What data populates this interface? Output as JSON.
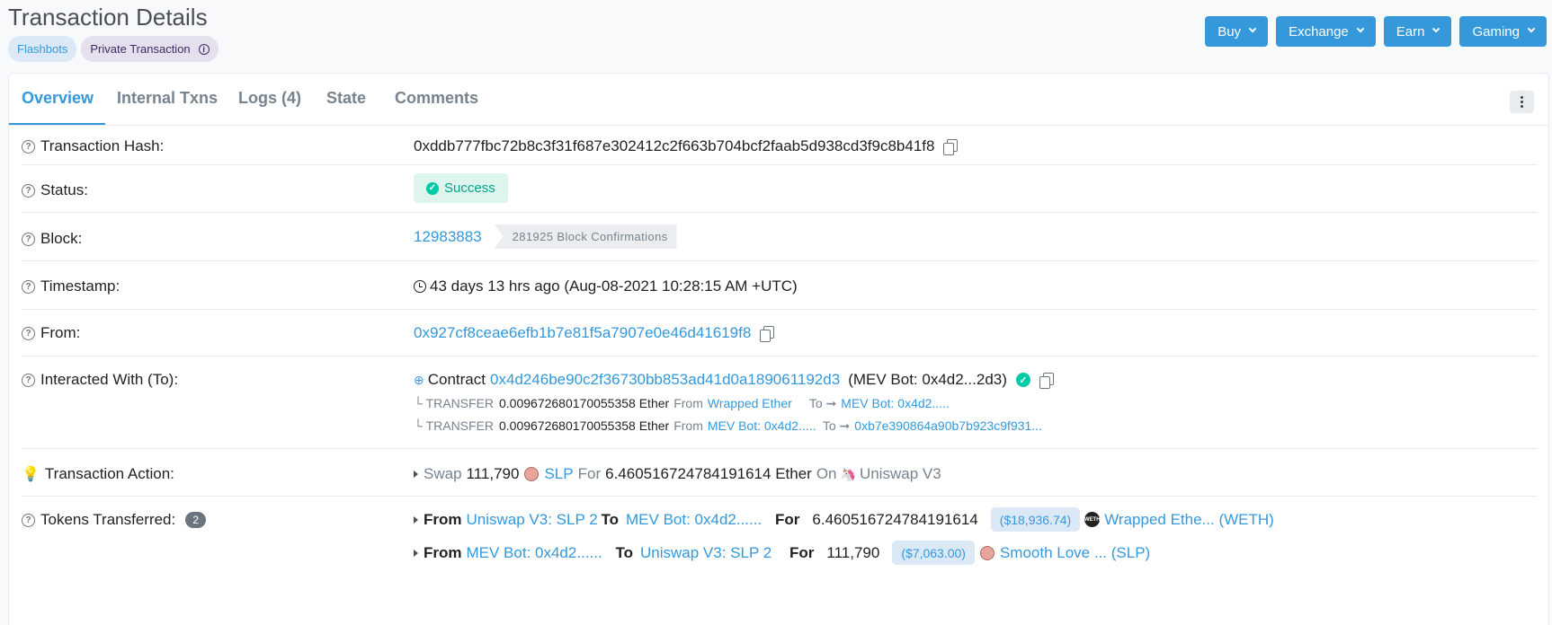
{
  "page": {
    "title": "Transaction Details",
    "badges": [
      "Flashbots",
      "Private Transaction"
    ]
  },
  "top_buttons": [
    "Buy",
    "Exchange",
    "Earn",
    "Gaming"
  ],
  "tabs": [
    "Overview",
    "Internal Txns",
    "Logs (4)",
    "State",
    "Comments"
  ],
  "details": {
    "hash": {
      "label": "Transaction Hash:",
      "value": "0xddb777fbc72b8c3f31f687e302412c2f663b704bcf2faab5d938cd3f9c8b41f8"
    },
    "status": {
      "label": "Status:",
      "value": "Success"
    },
    "block": {
      "label": "Block:",
      "value": "12983883",
      "confirmations": "281925 Block Confirmations"
    },
    "timestamp": {
      "label": "Timestamp:",
      "value": "43 days 13 hrs ago (Aug-08-2021 10:28:15 AM +UTC)"
    },
    "from": {
      "label": "From:",
      "value": "0x927cf8ceae6efb1b7e81f5a7907e0e46d41619f8"
    },
    "interacted": {
      "label": "Interacted With (To):",
      "prefix": "Contract",
      "address": "0x4d246be90c2f36730bb853ad41d0a189061192d3",
      "name": "(MEV Bot: 0x4d2...2d3)",
      "transfers": [
        {
          "type": "TRANSFER",
          "amount": "0.009672680170055358 Ether",
          "from_label": "From",
          "from": "Wrapped Ether",
          "to_label": "To",
          "to": "MEV Bot: 0x4d2....."
        },
        {
          "type": "TRANSFER",
          "amount": "0.009672680170055358 Ether",
          "from_label": "From",
          "from": "MEV Bot: 0x4d2.....",
          "to_label": "To",
          "to": "0xb7e390864a90b7b923c9f931..."
        }
      ]
    },
    "action": {
      "label": "Transaction Action:",
      "swap": "Swap",
      "amount_in": "111,790",
      "token_in": "SLP",
      "for": "For",
      "amount_out": "6.460516724784191614 Ether",
      "on": "On",
      "dex": "Uniswap V3"
    },
    "tokens": {
      "label": "Tokens Transferred:",
      "count": "2",
      "rows": [
        {
          "from_label": "From",
          "from": "Uniswap V3: SLP 2",
          "to_label": "To",
          "to": "MEV Bot: 0x4d2......",
          "for_label": "For",
          "amount": "6.460516724784191614",
          "usd": "($18,936.74)",
          "token": "Wrapped Ethe... (WETH)"
        },
        {
          "from_label": "From",
          "from": "MEV Bot: 0x4d2......",
          "to_label": "To",
          "to": "Uniswap V3: SLP 2",
          "for_label": "For",
          "amount": "111,790",
          "usd": "($7,063.00)",
          "token": "Smooth Love ... (SLP)"
        }
      ]
    }
  }
}
